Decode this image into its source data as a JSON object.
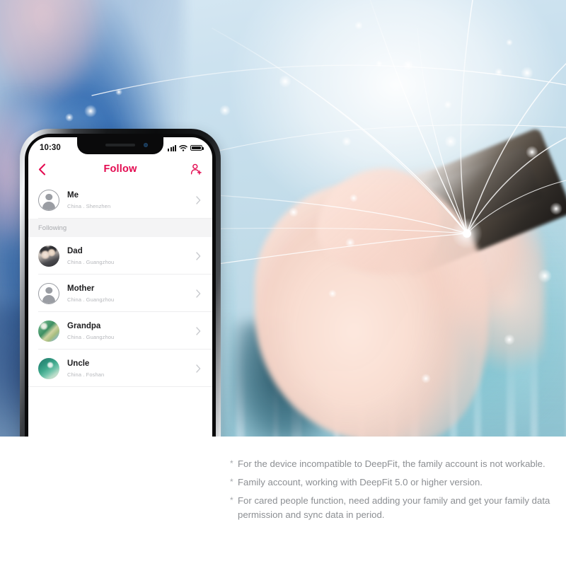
{
  "phone": {
    "status_bar": {
      "time": "10:30",
      "signal_icon": "cellular-signal-icon",
      "wifi_icon": "wifi-icon",
      "battery_icon": "battery-full-icon"
    },
    "nav": {
      "back_icon": "chevron-left-icon",
      "title": "Follow",
      "add_icon": "add-person-icon"
    },
    "me_row": {
      "name": "Me",
      "location": "China . Shenzhen",
      "avatar": "default-user-avatar",
      "chevron": "chevron-right-icon"
    },
    "section_header": "Following",
    "following": [
      {
        "name": "Dad",
        "location": "China . Guangzhou",
        "avatar": "couple-photo-avatar",
        "chevron": "chevron-right-icon"
      },
      {
        "name": "Mother",
        "location": "China . Guangzhou",
        "avatar": "default-user-avatar",
        "chevron": "chevron-right-icon"
      },
      {
        "name": "Grandpa",
        "location": "China . Guangzhou",
        "avatar": "landscape-photo-avatar",
        "chevron": "chevron-right-icon"
      },
      {
        "name": "Uncle",
        "location": "China . Foshan",
        "avatar": "seascape-photo-avatar",
        "chevron": "chevron-right-icon"
      }
    ],
    "home_indicator": "home-indicator-bar"
  },
  "notes": {
    "bullet": "*",
    "items": [
      "For the device incompatible to DeepFit, the family account is not workable.",
      "Family account, working with DeepFit 5.0 or higher version.",
      "For cared people function, need adding your family and get your family data permission and sync data in period."
    ]
  },
  "colors": {
    "accent": "#e30a50",
    "note_text": "#8c8f93",
    "section_bg": "#f4f4f5",
    "name_text": "#1c1c1e",
    "sub_text": "#b6b8bc"
  }
}
